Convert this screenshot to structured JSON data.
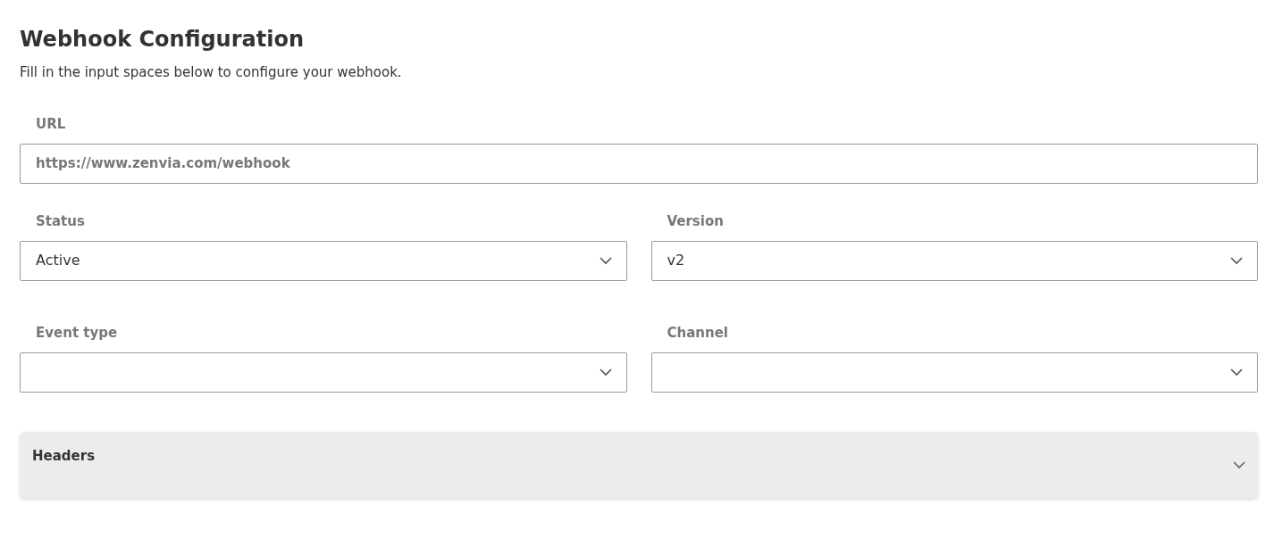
{
  "title": "Webhook Configuration",
  "subtitle": "Fill in the input spaces below to configure your webhook.",
  "url": {
    "label": "URL",
    "placeholder": "https://www.zenvia.com/webhook"
  },
  "selects": [
    {
      "label": "Status",
      "value": "Active"
    },
    {
      "label": "Version",
      "value": "v2"
    },
    {
      "label": "Event type"
    },
    {
      "label": "Channel"
    }
  ],
  "headers": {
    "label": "Headers",
    "expanded": false
  }
}
